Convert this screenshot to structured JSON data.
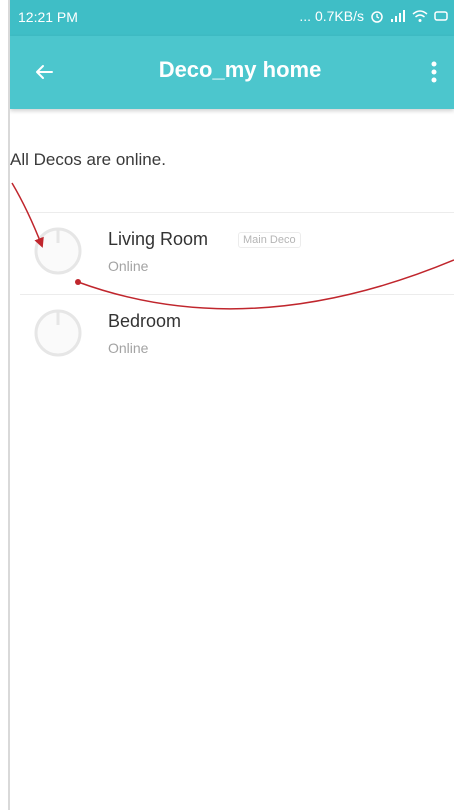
{
  "status_bar": {
    "time": "12:21 PM",
    "network_speed": "... 0.7KB/s",
    "icons": [
      "alarm-icon",
      "signal-icon",
      "wifi-icon",
      "battery-icon"
    ]
  },
  "app_bar": {
    "title": "Deco_my home",
    "back_icon": "arrow-left-icon",
    "menu_icon": "more-vertical-icon",
    "background_color": "#4cc6cd"
  },
  "main": {
    "status_message": "All Decos are online.",
    "decos": [
      {
        "name": "Living Room",
        "badge": "Main Deco",
        "status": "Online"
      },
      {
        "name": "Bedroom",
        "badge": "",
        "status": "Online"
      }
    ]
  },
  "annotation": {
    "color": "#c0262d"
  }
}
